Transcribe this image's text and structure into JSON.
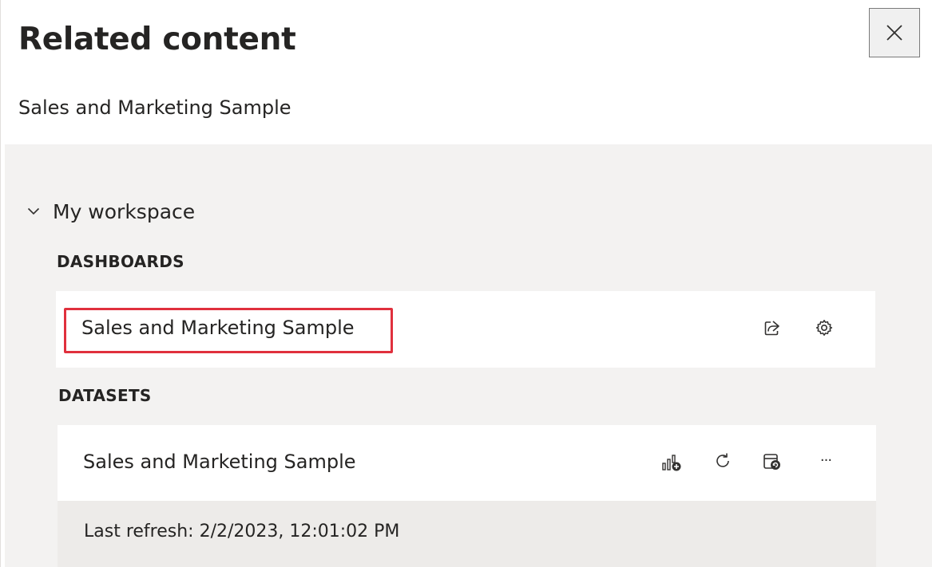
{
  "panel": {
    "title": "Related content",
    "subtitle": "Sales and Marketing Sample",
    "close_icon": "close-icon"
  },
  "workspace": {
    "label": "My workspace",
    "expanded": true,
    "chevron_icon": "chevron-down-icon"
  },
  "dashboards": {
    "heading": "DASHBOARDS",
    "items": [
      {
        "name": "Sales and Marketing Sample",
        "highlighted": true,
        "actions": [
          "share-icon",
          "settings-icon"
        ]
      }
    ]
  },
  "datasets": {
    "heading": "DATASETS",
    "items": [
      {
        "name": "Sales and Marketing Sample",
        "actions": [
          "create-report-icon",
          "refresh-icon",
          "schedule-refresh-icon",
          "more-options-icon"
        ],
        "more_label": "···",
        "last_refresh": "Last refresh: 2/2/2023, 12:01:02 PM"
      }
    ]
  },
  "colors": {
    "highlight": "#e0303d",
    "panel_gray": "#f3f2f1",
    "refresh_gray": "#edebe9",
    "text": "#252423"
  }
}
